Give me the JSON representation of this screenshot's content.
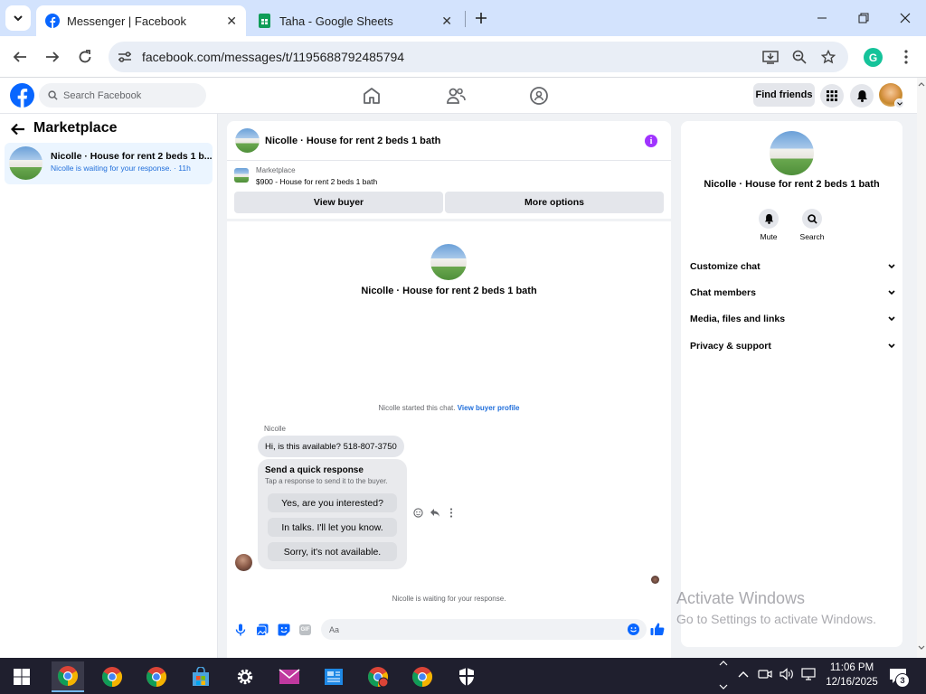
{
  "browser": {
    "tabs": [
      {
        "title": "Messenger | Facebook",
        "active": true
      },
      {
        "title": "Taha - Google Sheets",
        "active": false
      }
    ],
    "url": "facebook.com/messages/t/1195688792485794"
  },
  "fb_header": {
    "search_placeholder": "Search Facebook",
    "find_friends": "Find friends"
  },
  "sidebar": {
    "title": "Marketplace",
    "threads": [
      {
        "name": "Nicolle · House for rent 2 beds 1 b...",
        "preview": "Nicolle is waiting for your response. · 11h"
      }
    ]
  },
  "chat": {
    "header_title": "Nicolle · House for rent 2 beds 1 bath",
    "listing_source": "Marketplace",
    "listing_title": "$900 - House for rent 2 beds 1 bath",
    "view_buyer": "View buyer",
    "more_options": "More options",
    "center_title": "Nicolle · House for rent 2 beds 1 bath",
    "started_text": "Nicolle started this chat.",
    "buyer_profile_link": "View buyer profile",
    "sender_name": "Nicolle",
    "message": "Hi, is this available? 518-807-3750",
    "quick_title": "Send a quick response",
    "quick_subtitle": "Tap a response to send it to the buyer.",
    "quick_responses": [
      "Yes, are you interested?",
      "In talks. I'll let you know.",
      "Sorry, it's not available."
    ],
    "waiting_text": "Nicolle is waiting for your response.",
    "composer_placeholder": "Aa"
  },
  "details": {
    "title": "Nicolle · House for rent 2 beds 1 bath",
    "mute": "Mute",
    "search": "Search",
    "sections": [
      "Customize chat",
      "Chat members",
      "Media, files and links",
      "Privacy & support"
    ]
  },
  "watermark": {
    "line1": "Activate Windows",
    "line2": "Go to Settings to activate Windows."
  },
  "taskbar": {
    "time": "11:06 PM",
    "date": "12/16/2025",
    "notifications": "3"
  },
  "colors": {
    "fb_blue": "#0866ff",
    "link_blue": "#216fdb",
    "info_purple": "#a033ff"
  }
}
